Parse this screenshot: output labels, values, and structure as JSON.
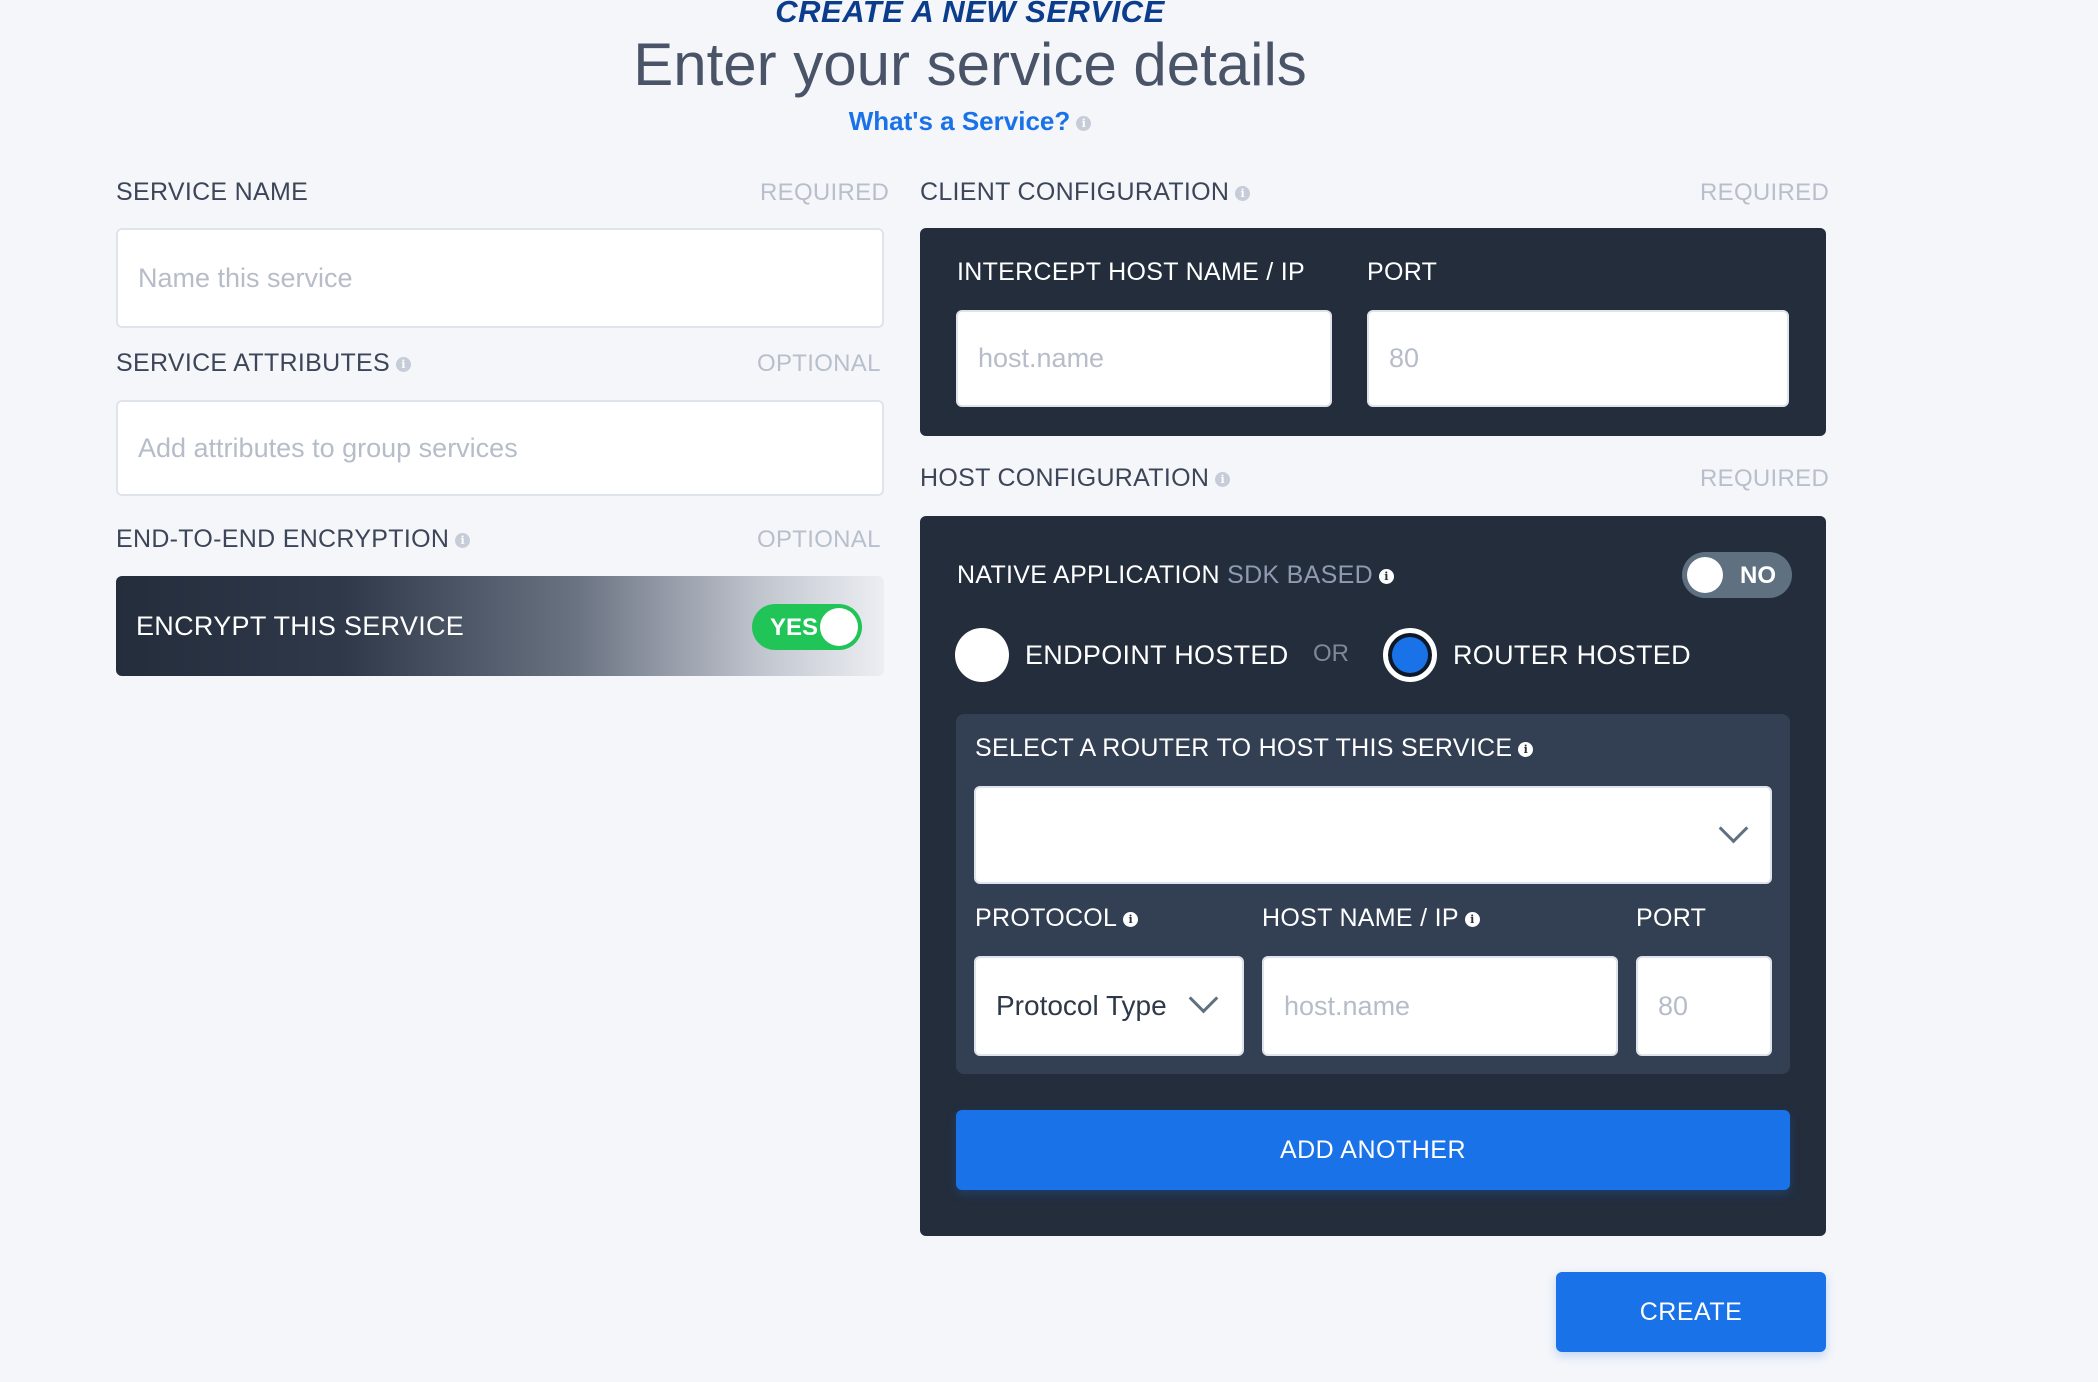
{
  "header": {
    "supertitle": "CREATE A NEW SERVICE",
    "title": "Enter your service details",
    "help_link": "What's a Service?"
  },
  "left": {
    "service_name": {
      "label": "SERVICE NAME",
      "tag": "REQUIRED",
      "placeholder": "Name this service"
    },
    "service_attributes": {
      "label": "SERVICE ATTRIBUTES",
      "tag": "OPTIONAL",
      "placeholder": "Add attributes to group services"
    },
    "encryption": {
      "label": "END-TO-END ENCRYPTION",
      "tag": "OPTIONAL",
      "bar_label": "ENCRYPT THIS SERVICE",
      "toggle_label": "YES",
      "enabled": true
    }
  },
  "client": {
    "label": "CLIENT CONFIGURATION",
    "tag": "REQUIRED",
    "host_label": "INTERCEPT HOST NAME / IP",
    "host_placeholder": "host.name",
    "port_label": "PORT",
    "port_placeholder": "80"
  },
  "host": {
    "label": "HOST CONFIGURATION",
    "tag": "REQUIRED",
    "native_label": "NATIVE APPLICATION",
    "native_sub": "SDK BASED",
    "native_toggle": "NO",
    "endpoint_label": "ENDPOINT HOSTED",
    "or_label": "OR",
    "router_label": "ROUTER HOSTED",
    "selected_mode": "ROUTER HOSTED",
    "router_select_label": "SELECT A ROUTER TO HOST THIS SERVICE",
    "router_select_value": "",
    "protocol_label": "PROTOCOL",
    "protocol_value": "Protocol Type",
    "hostname_label": "HOST NAME / IP",
    "hostname_placeholder": "host.name",
    "port_label": "PORT",
    "port_placeholder": "80",
    "add_another": "ADD ANOTHER"
  },
  "actions": {
    "create": "CREATE"
  },
  "colors": {
    "accent": "#1a72e8",
    "panel": "#232d3c",
    "toggle_on": "#21c457",
    "toggle_off": "#5f7080"
  }
}
